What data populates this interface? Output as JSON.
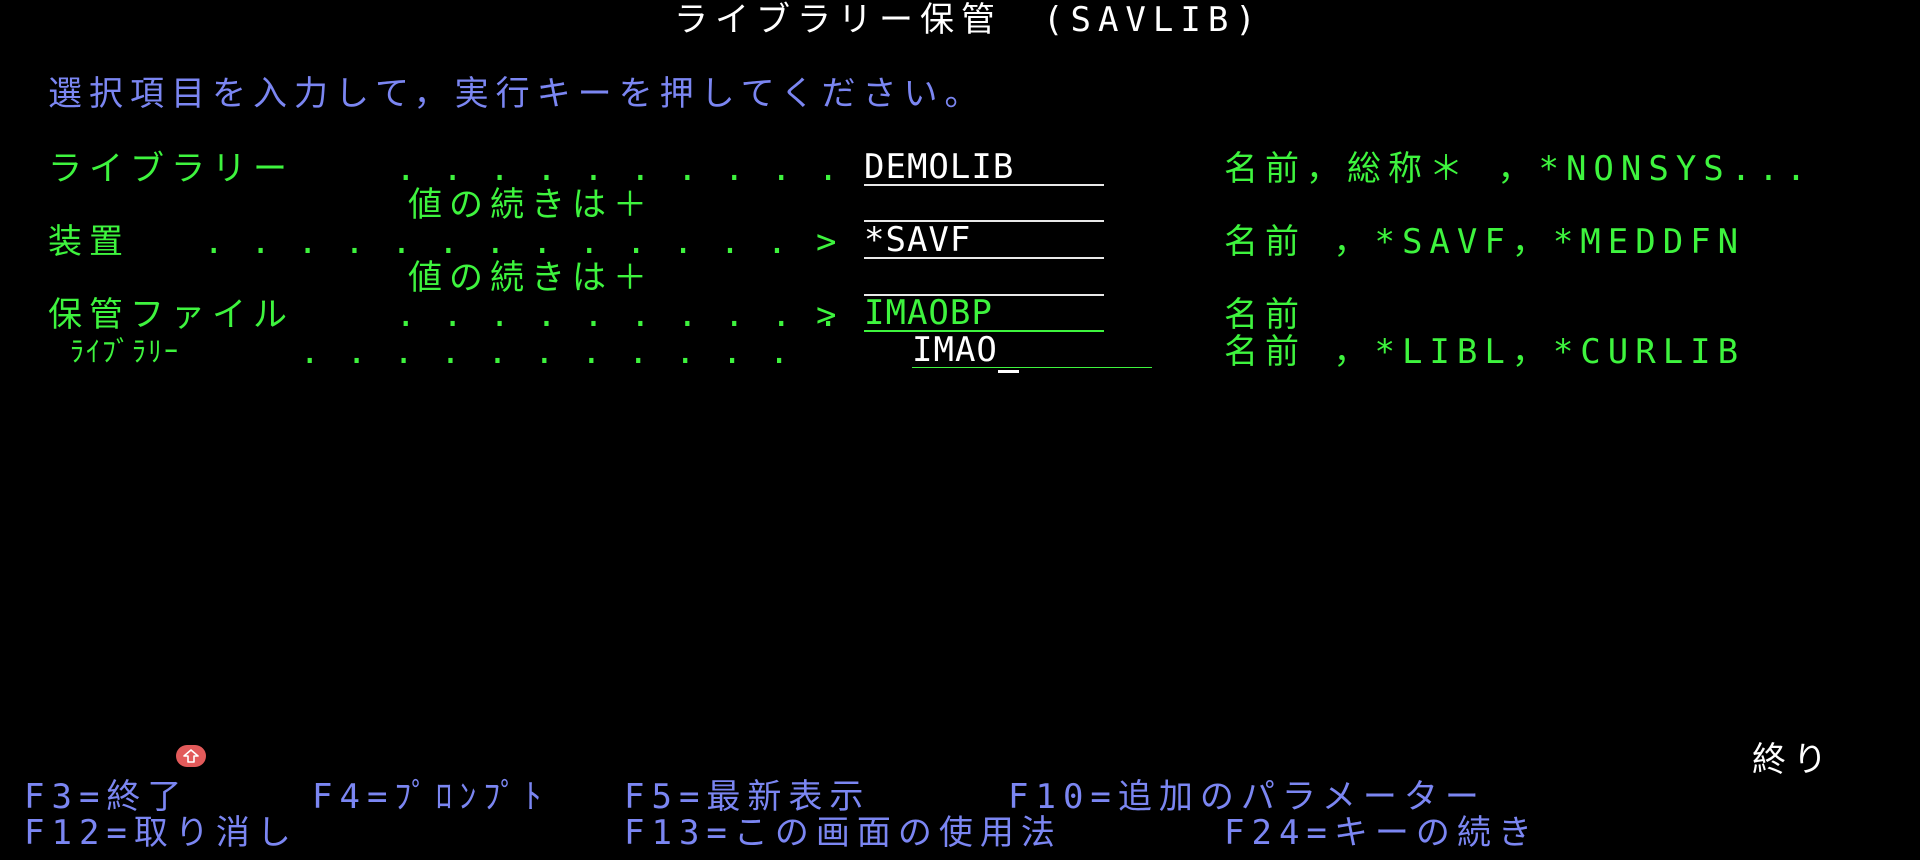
{
  "header": {
    "title": "ライブラリー保管　(SAVLIB)",
    "instruction": "選択項目を入力して，実行キーを押してください。"
  },
  "params": {
    "library": {
      "label": "ライブラリー",
      "dots": " . . . . . . . . . .",
      "value": "DEMOLIB",
      "hint": "名前，総称＊ ，*NONSYS..."
    },
    "library_more": {
      "label": "値の続きは＋"
    },
    "device": {
      "label": "装置",
      "dots": " . . . . . . . . . . . . .",
      "marker": ">",
      "value": "*SAVF",
      "hint": "名前 ，*SAVF，*MEDDFN"
    },
    "device_more": {
      "label": "値の続きは＋"
    },
    "save_file": {
      "label": "保管ファイル",
      "dots": " . . . . . . . . . .",
      "marker": ">",
      "value": "IMAOBP",
      "hint": "名前"
    },
    "save_file_library": {
      "label": "ﾗｲﾌﾞﾗﾘｰ",
      "dots": " . . . . . . . . . . .",
      "value": "IMAO",
      "hint": "名前 ，*LIBL，*CURLIB"
    }
  },
  "status": {
    "more_indicator": "終り",
    "indicator_icon": "keyboard-shift-icon"
  },
  "fkeys": {
    "f3": "F3=終了",
    "f4": "F4=ﾌﾟﾛﾝﾌﾟﾄ",
    "f5": "F5=最新表示",
    "f10": "F10=追加のパラメーター",
    "f12": "F12=取り消し",
    "f13": "F13=この画面の使用法",
    "f24": "F24=キーの続き"
  },
  "colors": {
    "background": "#000000",
    "field_text": "#3ef43e",
    "instruction_text": "#7b86f2",
    "input_text": "#ffffff",
    "indicator": "#e25a5a"
  }
}
